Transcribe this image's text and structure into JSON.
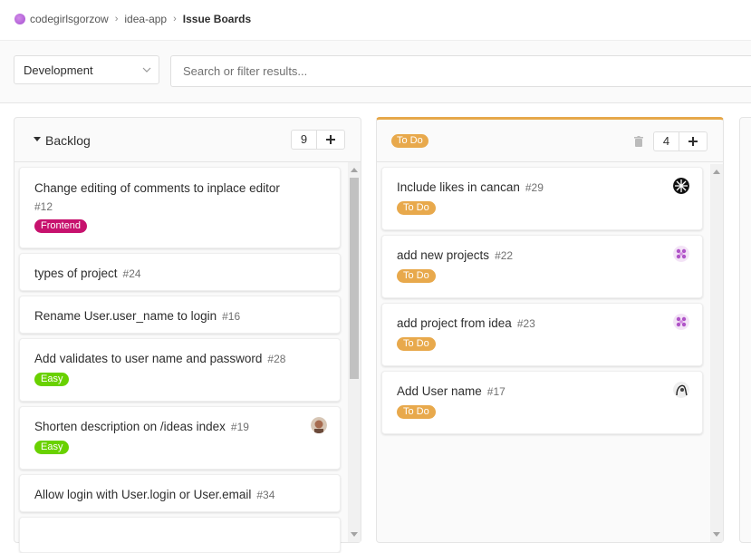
{
  "breadcrumb": {
    "group": "codegirlsgorzow",
    "project": "idea-app",
    "current": "Issue Boards"
  },
  "filters": {
    "board": "Development",
    "search_placeholder": "Search or filter results..."
  },
  "lists": {
    "backlog": {
      "title": "Backlog",
      "count": "9",
      "cards": [
        {
          "title": "Change editing of comments to inplace editor",
          "num": "#12",
          "label": "Frontend",
          "label_color": "#c7126e"
        },
        {
          "title": "types of project",
          "num": "#24"
        },
        {
          "title": "Rename User.user_name to login",
          "num": "#16"
        },
        {
          "title": "Add validates to user name and password",
          "num": "#28",
          "label": "Easy",
          "label_color": "#69d100"
        },
        {
          "title": "Shorten description on /ideas index",
          "num": "#19",
          "label": "Easy",
          "label_color": "#69d100",
          "avatar": "photo-avatar"
        },
        {
          "title": "Allow login with User.login or User.email",
          "num": "#34"
        }
      ]
    },
    "todo": {
      "title": "To Do",
      "label_color": "#e8a94c",
      "count": "4",
      "cards": [
        {
          "title": "Include likes in cancan",
          "num": "#29",
          "label": "To Do",
          "avatar": "dark-pattern-avatar"
        },
        {
          "title": "add new projects",
          "num": "#22",
          "label": "To Do",
          "avatar": "purple-identicon-avatar"
        },
        {
          "title": "add project from idea",
          "num": "#23",
          "label": "To Do",
          "avatar": "purple-identicon-avatar"
        },
        {
          "title": "Add User name",
          "num": "#17",
          "label": "To Do",
          "avatar": "sketch-avatar"
        }
      ]
    }
  }
}
